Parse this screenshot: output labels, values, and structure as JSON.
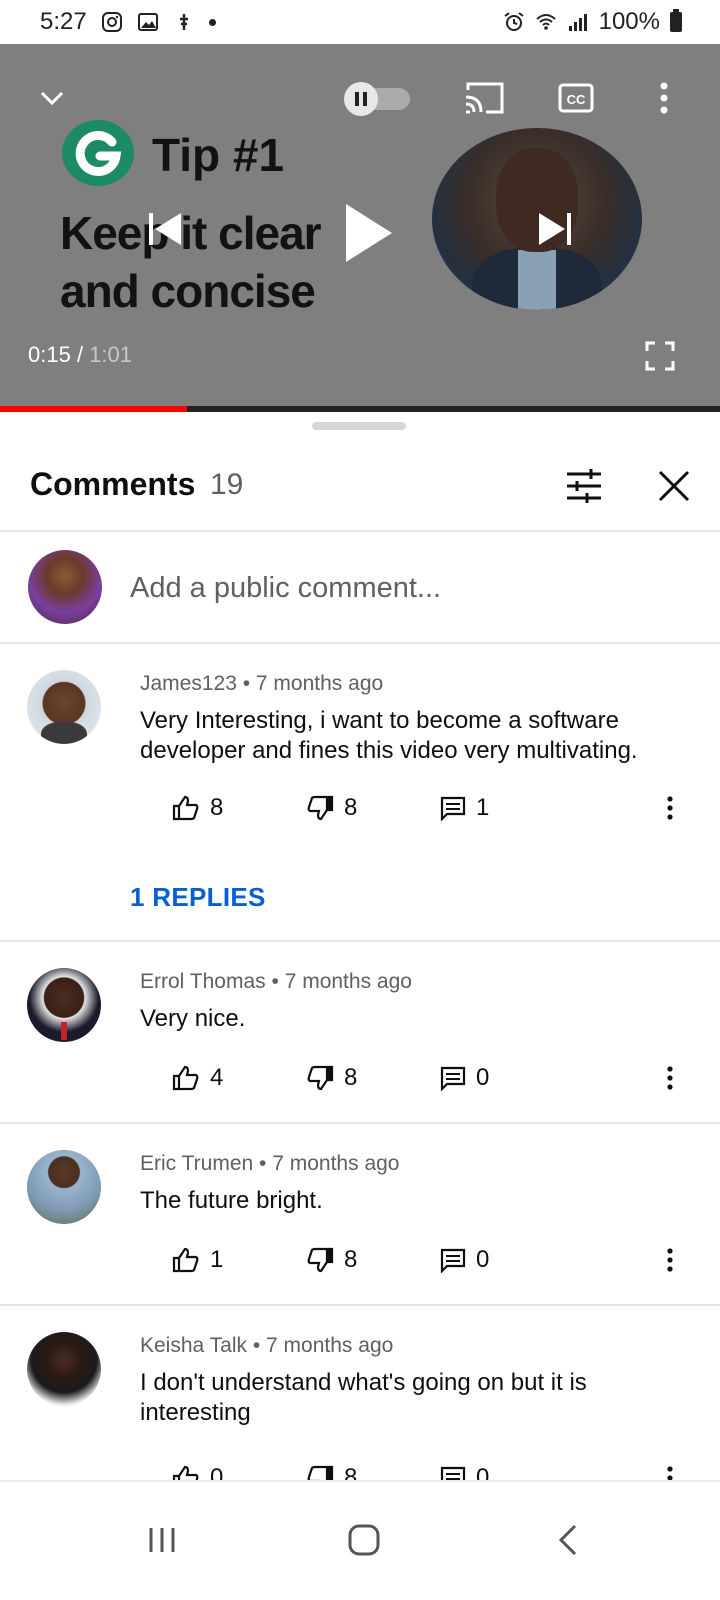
{
  "status_bar": {
    "time": "5:27",
    "battery": "100%"
  },
  "player": {
    "video_brand_line": "Tip #1",
    "video_headline_1": "Keep it clear",
    "video_headline_2": "and concise",
    "time_current": "0:15",
    "time_separator": " / ",
    "time_total": "1:01",
    "progress_fraction": 0.26
  },
  "comments_panel": {
    "title": "Comments",
    "count": "19",
    "composer_placeholder": "Add a public comment...",
    "replies_link": "1 REPLIES"
  },
  "comments": [
    {
      "author": "James123",
      "age": "7 months ago",
      "text": "Very Interesting, i want to become a software developer and fines this video very multivating.",
      "likes": "8",
      "dislikes": "8",
      "replies": "1"
    },
    {
      "author": "Errol Thomas",
      "age": "7 months ago",
      "text": "Very nice.",
      "likes": "4",
      "dislikes": "8",
      "replies": "0"
    },
    {
      "author": "Eric Trumen",
      "age": "7 months ago",
      "text": "The future bright.",
      "likes": "1",
      "dislikes": "8",
      "replies": "0"
    },
    {
      "author": "Keisha Talk",
      "age": "7 months ago",
      "text": "I don't understand what's going on but it is interesting",
      "likes": "0",
      "dislikes": "8",
      "replies": "0"
    }
  ],
  "icons": {
    "collapse": "chevron-down-icon",
    "autoplay": "autoplay-toggle-icon",
    "cast": "cast-icon",
    "captions": "closed-captions-icon",
    "more": "more-vert-icon",
    "previous": "skip-previous-icon",
    "play": "play-icon",
    "next": "skip-next-icon",
    "fullscreen": "fullscreen-icon",
    "filter": "sort-filter-icon",
    "close": "close-icon",
    "like": "thumb-up-icon",
    "dislike": "thumb-down-icon",
    "reply": "comment-reply-icon"
  },
  "colors": {
    "player_bg": "#7f7f7f",
    "progress": "#ff0000",
    "link_blue": "#065fd4",
    "brand_green": "#1c8a62",
    "meta_gray": "#606060"
  }
}
